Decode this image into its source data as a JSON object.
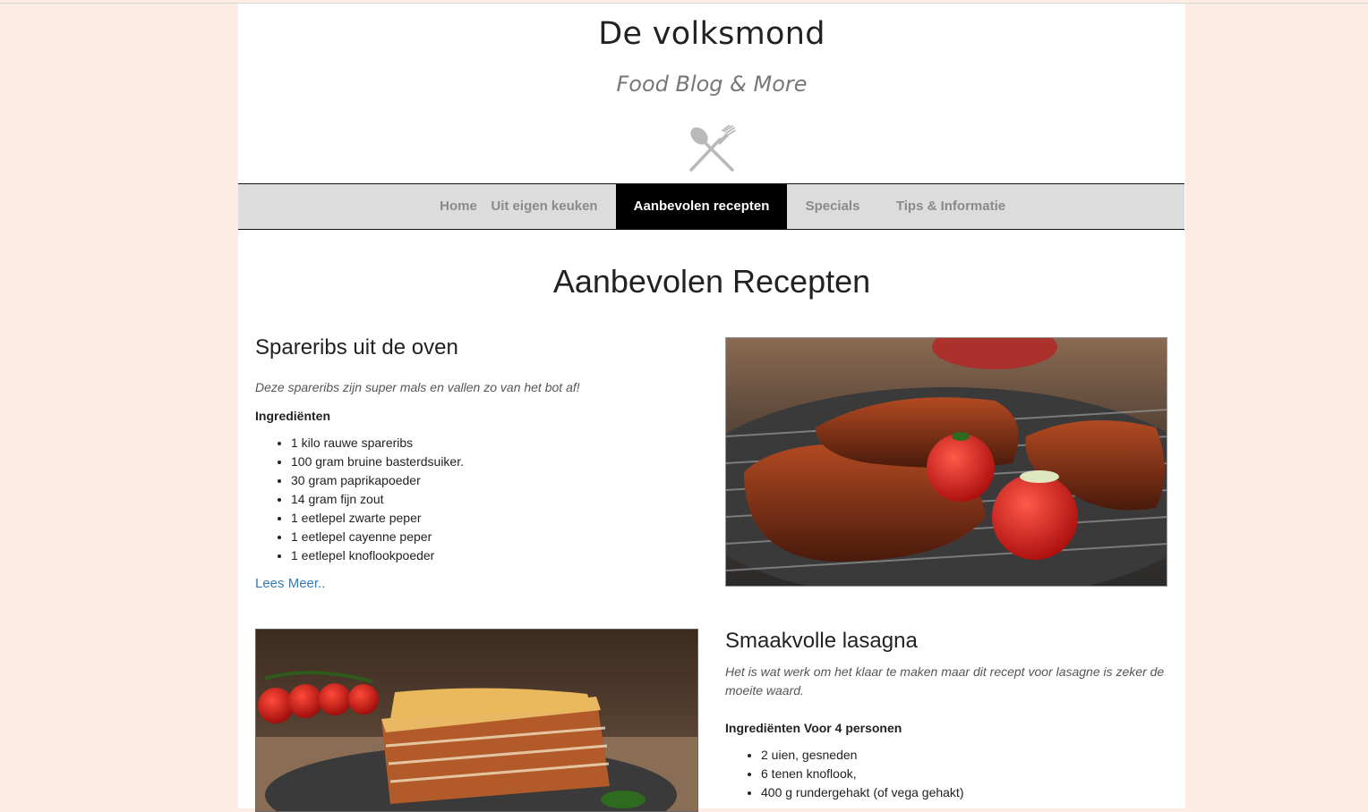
{
  "header": {
    "site_title": "De volksmond",
    "tagline": "Food Blog & More",
    "logo_icon": "spoon-fork-crossed-icon"
  },
  "nav": {
    "items": [
      {
        "label": "Home",
        "active": false
      },
      {
        "label": "Uit eigen keuken",
        "active": false
      },
      {
        "label": "Aanbevolen recepten",
        "active": true
      },
      {
        "label": "Specials",
        "active": false
      },
      {
        "label": "Tips & Informatie",
        "active": false
      }
    ]
  },
  "main": {
    "heading": "Aanbevolen Recepten",
    "recipes": [
      {
        "title": "Spareribs uit de oven",
        "description": "Deze spareribs zijn super mals en vallen zo van het bot af!",
        "ingredients_heading": "Ingrediënten",
        "ingredients": [
          "1 kilo rauwe spareribs",
          "100 gram bruine basterdsuiker.",
          "30 gram paprikapoeder",
          "14 gram fijn zout",
          "1 eetlepel zwarte peper",
          "1 eetlepel cayenne peper",
          "1 eetlepel knoflookpoeder"
        ],
        "read_more": "Lees Meer.."
      },
      {
        "title": "Smaakvolle lasagna",
        "description": "Het is wat werk om het klaar te maken maar dit recept voor lasagne is zeker de moeite waard.",
        "ingredients_heading": "Ingrediënten Voor 4 personen",
        "ingredients": [
          "2 uien, gesneden",
          "6 tenen knoflook,",
          "400 g rundergehakt (of vega gehakt)"
        ]
      }
    ]
  },
  "colors": {
    "page_background": "#fdece3",
    "nav_background": "#dcdcdc",
    "nav_active": "#000000",
    "link": "#337ab7"
  }
}
